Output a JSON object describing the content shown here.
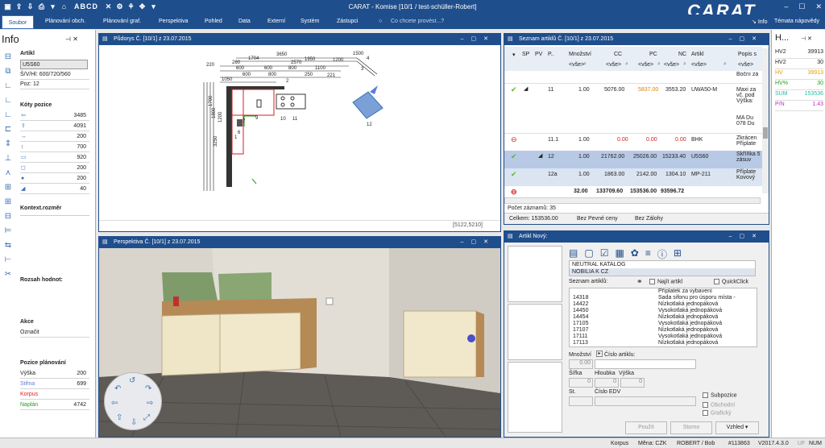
{
  "app": {
    "title": "CARAT - Komise [10/1 / test-schüller-Robert]",
    "logo": "CARAT",
    "quick_letters": "ABCD"
  },
  "menu": {
    "items": [
      "Soubor",
      "Plánování obch.",
      "Plánování graf.",
      "Perspektiva",
      "Pohled",
      "Data",
      "Externí",
      "Systém",
      "Zástupci"
    ],
    "search_placeholder": "Co chcete provést...?",
    "info": "Info",
    "help": "Témata nápovědy"
  },
  "info_panel": {
    "title": "Info",
    "artikl_label": "Artikl",
    "artikl_value": "U5S60",
    "dims": "Š/V/Hl: 600/720/560",
    "poz": "Poz: 12",
    "koty_label": "Kóty pozice",
    "koty": [
      "3485",
      "4091",
      "200",
      "700",
      "920",
      "200",
      "200",
      "40"
    ],
    "kontext_label": "Kontext.rozměr",
    "rozsah_label": "Rozsah hodnot:",
    "akce_label": "Akce",
    "akce_item": "Označit",
    "pozice_label": "Pozice plánování",
    "pozice": [
      {
        "label": "Výška",
        "value": "200",
        "color": "#222222"
      },
      {
        "label": "Stěna",
        "value": "699",
        "color": "#5a7fd6"
      },
      {
        "label": "Korpus",
        "value": "",
        "color": "#e02020"
      },
      {
        "label": "Naplán",
        "value": "4742",
        "color": "#20a020"
      }
    ]
  },
  "pudorys": {
    "title": "Půdorys Č. [10/1] z 23.07.2015",
    "coords": "[5122,5210]",
    "dims": [
      "3650",
      "1950",
      "1704",
      "1500",
      "1200",
      "200",
      "600",
      "600",
      "800",
      "1100",
      "250",
      "1050",
      "2570",
      "220",
      "260",
      "600",
      "800",
      "250",
      "3250",
      "1800",
      "1200",
      "1700",
      "221"
    ],
    "labels": [
      "1",
      "2",
      "3",
      "4",
      "6",
      "7",
      "9",
      "10",
      "11",
      "12"
    ]
  },
  "perspektiva": {
    "title": "Perspektiva Č. [10/1] z 23.07.2015"
  },
  "seznam": {
    "title": "Seznam artiklů Č. [10/1] z 23.07.2015",
    "columns": [
      "SP",
      "PV",
      "P..",
      "Množství",
      "CC",
      "PC",
      "NC",
      "Artikl",
      "Popis s"
    ],
    "filter_placeholder": "<vše>",
    "rows": [
      {
        "pos": "",
        "qty": "",
        "cc": "",
        "pc": "",
        "nc": "",
        "artikl": "",
        "popis": "Boční zá"
      },
      {
        "pos": "11",
        "qty": "1.00",
        "cc": "5076.00",
        "pc": "5837.00",
        "nc": "3553.20",
        "artikl": "UWA50-M",
        "popis": "Maxi za vč. pod Výška:",
        "status": "ok"
      },
      {
        "pos": "",
        "qty": "",
        "cc": "",
        "pc": "",
        "nc": "",
        "artikl": "",
        "popis": "MA Du 078 Du"
      },
      {
        "pos": "11.1",
        "qty": "1.00",
        "cc": "0.00",
        "pc": "0.00",
        "nc": "0.00",
        "artikl": "BHK",
        "popis": "Zkrácen Příplate",
        "status": "err"
      },
      {
        "pos": "12",
        "qty": "1.00",
        "cc": "21762.00",
        "pc": "25026.00",
        "nc": "15233.40",
        "artikl": "U5S60",
        "popis": "Skříňka 5 zásuv",
        "status": "ok"
      },
      {
        "pos": "12a",
        "qty": "1.00",
        "cc": "1863.00",
        "pc": "2142.00",
        "nc": "1304.10",
        "artikl": "MP-211",
        "popis": "Příplate Kovový",
        "status": "ok"
      }
    ],
    "totals": {
      "qty": "32.00",
      "cc": "133709.60",
      "pc": "153536.00",
      "nc": "93596.72"
    },
    "count": "Počet záznamů: 35",
    "celkem": "Celkem: 153536.00",
    "bez_ceny": "Bez Pevné ceny",
    "bez_zalohy": "Bez Zálohy"
  },
  "right_panel": {
    "title": "H...",
    "rows": [
      {
        "label": "HV2",
        "value": "39913",
        "color": "#222222"
      },
      {
        "label": "HV2",
        "value": "30",
        "color": "#222222"
      },
      {
        "label": "HV",
        "value": "39913",
        "color": "#e0a000"
      },
      {
        "label": "HV%",
        "value": "30",
        "color": "#20a020"
      },
      {
        "label": "SUM",
        "value": "153536",
        "color": "#20c0a0"
      },
      {
        "label": "P/N",
        "value": "1.43",
        "color": "#d020d0"
      }
    ]
  },
  "artikl_novy": {
    "title": "Artikl Nový:",
    "catalogs": [
      "NEUTRAL KATALOG",
      "NOBILIA K CZ"
    ],
    "seznam_label": "Seznam artiklů:",
    "najit": "Najít artikl",
    "quickclick": "QuickClick",
    "list": [
      {
        "code": "",
        "name": "Příplatek za vybavení"
      },
      {
        "code": "14318",
        "name": "Sada sifonu pro úsporu místa -"
      },
      {
        "code": "14422",
        "name": "Nízkotlaká jednopáková"
      },
      {
        "code": "14450",
        "name": "Vysokotlaká jednopáková"
      },
      {
        "code": "14454",
        "name": "Nízkotlaká jednopáková"
      },
      {
        "code": "17105",
        "name": "Vysokotlaká jednopáková"
      },
      {
        "code": "17107",
        "name": "Nízkotlaká jednopáková"
      },
      {
        "code": "17111",
        "name": "Vysokotlaká jednopáková"
      },
      {
        "code": "17113",
        "name": "Nízkotlaká jednopáková"
      }
    ],
    "mnozstvi": "Množství",
    "mnozstvi_val": "0.00",
    "cislo": "Číslo artiklu:",
    "sirka": "Šířka",
    "hloubka": "Hloubka",
    "vyska": "Výška",
    "zero": "0",
    "st": "St.",
    "cislo_edv": "Číslo EDV",
    "subpozice": "Subpozice",
    "obchodni": "Obchodní",
    "graficky": "Grafický",
    "pouzit": "Použít",
    "storno": "Storno",
    "vzhled": "Vzhled"
  },
  "status": {
    "korpus": "Korpus",
    "mena": "Měna: CZK",
    "user": "ROBERT / Bob",
    "id": "#113863",
    "version": "V2017.4.3.0",
    "mode": "NUM",
    "uf": "UF"
  }
}
